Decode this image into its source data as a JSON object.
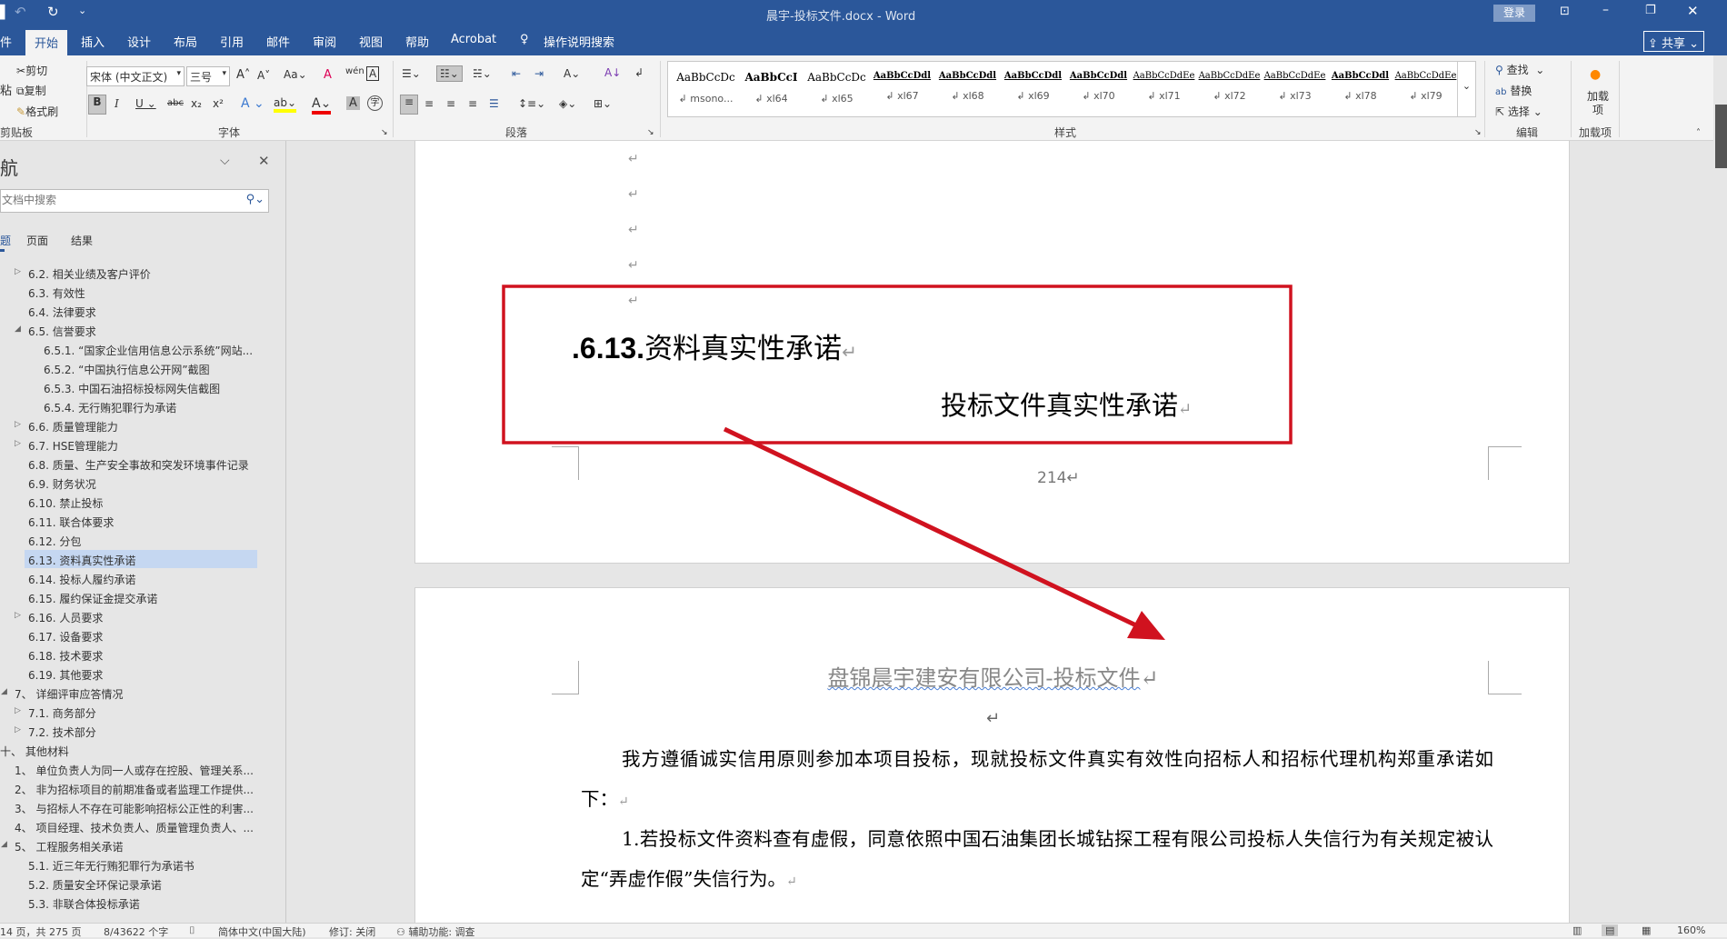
{
  "titlebar": {
    "title": "晨宇-投标文件.docx  -  Word",
    "login": "登录"
  },
  "tabs": [
    "件",
    "开始",
    "插入",
    "设计",
    "布局",
    "引用",
    "邮件",
    "审阅",
    "视图",
    "帮助",
    "Acrobat"
  ],
  "tell_me": "操作说明搜索",
  "share": "共享",
  "ribbon": {
    "clipboard": {
      "cut": "剪切",
      "copy": "复制",
      "format_painter": "格式刷",
      "paste": "粘",
      "label": "剪贴板"
    },
    "font": {
      "name": "宋体 (中文正文)",
      "size": "三号",
      "label": "字体"
    },
    "paragraph": {
      "label": "段落"
    },
    "styles": {
      "label": "样式",
      "items": [
        {
          "preview": "AaBbCcDc",
          "name": "msono..."
        },
        {
          "preview": "AaBbCcI",
          "name": "xl64"
        },
        {
          "preview": "AaBbCcDc",
          "name": "xl65"
        },
        {
          "preview": "AaBbCcDdl",
          "name": "xl67"
        },
        {
          "preview": "AaBbCcDdl",
          "name": "xl68"
        },
        {
          "preview": "AaBbCcDdl",
          "name": "xl69"
        },
        {
          "preview": "AaBbCcDdl",
          "name": "xl70"
        },
        {
          "preview": "AaBbCcDdEe",
          "name": "xl71"
        },
        {
          "preview": "AaBbCcDdEe",
          "name": "xl72"
        },
        {
          "preview": "AaBbCcDdEe",
          "name": "xl73"
        },
        {
          "preview": "AaBbCcDdl",
          "name": "xl78"
        },
        {
          "preview": "AaBbCcDdEe",
          "name": "xl79"
        }
      ]
    },
    "editing": {
      "find": "查找",
      "replace": "替换",
      "select": "选择",
      "label": "编辑"
    },
    "addins": {
      "button": "加载项",
      "label": "加载项"
    }
  },
  "nav": {
    "title": "航",
    "search_placeholder": "文档中搜索",
    "tabs": [
      "题",
      "页面",
      "结果"
    ],
    "items": [
      {
        "text": "6.2. 相关业绩及客户评价",
        "level": 1,
        "toggle": "collapsed"
      },
      {
        "text": "6.3. 有效性",
        "level": 1
      },
      {
        "text": "6.4. 法律要求",
        "level": 1
      },
      {
        "text": "6.5. 信誉要求",
        "level": 1,
        "toggle": "expanded"
      },
      {
        "text": "6.5.1. “国家企业信用信息公示系统”网站...",
        "level": 2
      },
      {
        "text": "6.5.2. “中国执行信息公开网”截图",
        "level": 2
      },
      {
        "text": "6.5.3. 中国石油招标投标网失信截图",
        "level": 2
      },
      {
        "text": "6.5.4. 无行贿犯罪行为承诺",
        "level": 2
      },
      {
        "text": "6.6. 质量管理能力",
        "level": 1,
        "toggle": "collapsed"
      },
      {
        "text": "6.7. HSE管理能力",
        "level": 1,
        "toggle": "collapsed"
      },
      {
        "text": "6.8. 质量、生产安全事故和突发环境事件记录",
        "level": 1
      },
      {
        "text": "6.9. 财务状况",
        "level": 1
      },
      {
        "text": "6.10. 禁止投标",
        "level": 1
      },
      {
        "text": "6.11. 联合体要求",
        "level": 1
      },
      {
        "text": "6.12. 分包",
        "level": 1
      },
      {
        "text": "6.13. 资料真实性承诺",
        "level": 1,
        "selected": true
      },
      {
        "text": "6.14. 投标人履约承诺",
        "level": 1
      },
      {
        "text": "6.15. 履约保证金提交承诺",
        "level": 1
      },
      {
        "text": "6.16. 人员要求",
        "level": 1,
        "toggle": "collapsed"
      },
      {
        "text": "6.17. 设备要求",
        "level": 1
      },
      {
        "text": "6.18. 技术要求",
        "level": 1
      },
      {
        "text": "6.19. 其他要求",
        "level": 1
      },
      {
        "text": "7、 详细评审应答情况",
        "level": 0,
        "toggle": "expanded"
      },
      {
        "text": "7.1. 商务部分",
        "level": 1,
        "toggle": "collapsed"
      },
      {
        "text": "7.2. 技术部分",
        "level": 1,
        "toggle": "collapsed"
      },
      {
        "text": "十、 其他材料",
        "level": -1
      },
      {
        "text": "1、 单位负责人为同一人或存在控股、管理关系...",
        "level": 0
      },
      {
        "text": "2、 非为招标项目的前期准备或者监理工作提供...",
        "level": 0
      },
      {
        "text": "3、 与招标人不存在可能影响招标公正性的利害...",
        "level": 0
      },
      {
        "text": "4、 项目经理、技术负责人、质量管理负责人、...",
        "level": 0
      },
      {
        "text": "5、 工程服务相关承诺",
        "level": 0,
        "toggle": "expanded"
      },
      {
        "text": "5.1. 近三年无行贿犯罪行为承诺书",
        "level": 1
      },
      {
        "text": "5.2. 质量安全环保记录承诺",
        "level": 1
      },
      {
        "text": "5.3. 非联合体投标承诺",
        "level": 1
      }
    ]
  },
  "document": {
    "heading": ".6.13.资料真实性承诺",
    "heading_num": ".6.13.",
    "heading_text": "资料真实性承诺",
    "subtitle": "投标文件真实性承诺",
    "page_number": "214",
    "header": "盘锦晨宇建安有限公司-投标文件",
    "paragraphs": [
      "我方遵循诚实信用原则参加本项目投标，现就投标文件真实有效性向招标人和招标代理机构郑重承诺如下：",
      "1.若投标文件资料查有虚假，同意依照中国石油集团长城钻探工程有限公司投标人失信行为有关规定被认定“弄虚作假”失信行为。"
    ],
    "annotation_color": "#d0121f"
  },
  "status": {
    "page": "14 页，共 275 页",
    "words": "8/43622 个字",
    "language": "简体中文(中国大陆)",
    "track": "修订: 关闭",
    "accessibility": "辅助功能: 调查",
    "zoom": "160%"
  }
}
